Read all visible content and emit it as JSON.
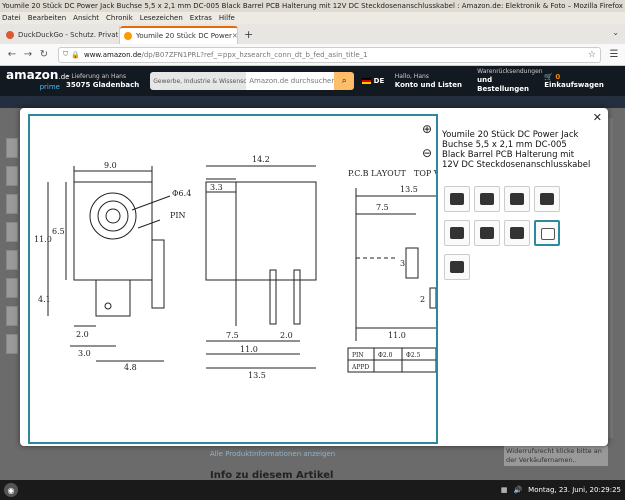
{
  "window": {
    "title": "Youmile 20 Stück DC Power Jack Buchse 5,5 x 2,1 mm DC-005 Black Barrel PCB Halterung mit 12V DC Steckdosenanschlusskabel : Amazon.de: Elektronik & Foto – Mozilla Firefox"
  },
  "menubar": [
    "Datei",
    "Bearbeiten",
    "Ansicht",
    "Chronik",
    "Lesezeichen",
    "Extras",
    "Hilfe"
  ],
  "tabs": [
    {
      "label": "DuckDuckGo - Schutz. Privat",
      "close": "✕",
      "active": false,
      "color": "#de5833"
    },
    {
      "label": "Youmile 20 Stück DC Power",
      "close": "✕",
      "active": true,
      "color": "#ff9900"
    }
  ],
  "nav": {
    "url_host": "www.amazon.de",
    "url_path": "/dp/B07ZFN1PRL?ref_=ppx_hzsearch_conn_dt_b_fed_asin_title_1"
  },
  "amazon": {
    "logo": "amazon",
    "logo_tld": ".de",
    "logo_sub": "prime",
    "loc_line1": "Lieferung an Hans",
    "loc_line2": "35075 Gladenbach",
    "search_category": "Gewerbe, Industrie & Wissenschaft",
    "search_placeholder": "Amazon.de durchsuchen",
    "lang": "DE",
    "account_line1": "Hallo, Hans",
    "account_line2": "Konto und Listen",
    "orders_line1": "Warenrücksendungen",
    "orders_line2": "und Bestellungen",
    "cart_count": "0",
    "cart_label": "Einkaufswagen"
  },
  "page": {
    "all_info_link": "Alle Produktinformationen anzeigen",
    "info_heading": "Info zu diesem Artikel",
    "right_text": "Widerrufsrecht klicke bitte an der Verkäufernamen.."
  },
  "modal": {
    "title": "Youmile 20 Stück DC Power Jack Buchse 5,5 x 2,1 mm DC-005 Black Barrel PCB Halterung mit 12V DC Steckdosenanschlusskabel",
    "close": "✕",
    "selected_thumb": 7
  },
  "drawing": {
    "dims": {
      "front_width": "9.0",
      "front_height": "11.0",
      "front_inner": "6.5",
      "front_pin_h": "4.1",
      "front_d1": "2.0",
      "front_d2": "3.0",
      "front_d3": "4.8",
      "hole": "Φ6.4",
      "pin": "PIN",
      "side_top": "14.2",
      "side_top_small": "3.3",
      "side_b1": "7.5",
      "side_b2": "2.0",
      "side_b3": "11.0",
      "side_b4": "13.5",
      "pcb_label": "P.C.B LAYOUT",
      "top_label": "TOP V",
      "pcb_top": "13.5",
      "pcb_mid": "7.5",
      "pcb_bottom": "11.0",
      "pcb_r1": "3",
      "pcb_r2": "2"
    },
    "table": {
      "r1c1": "PIN",
      "r1c2": "Φ2.0",
      "r1c3": "Φ2.5",
      "r2c1": "APPD"
    }
  },
  "taskbar": {
    "datetime": "Montag, 23. Juni, 20:29:25"
  }
}
